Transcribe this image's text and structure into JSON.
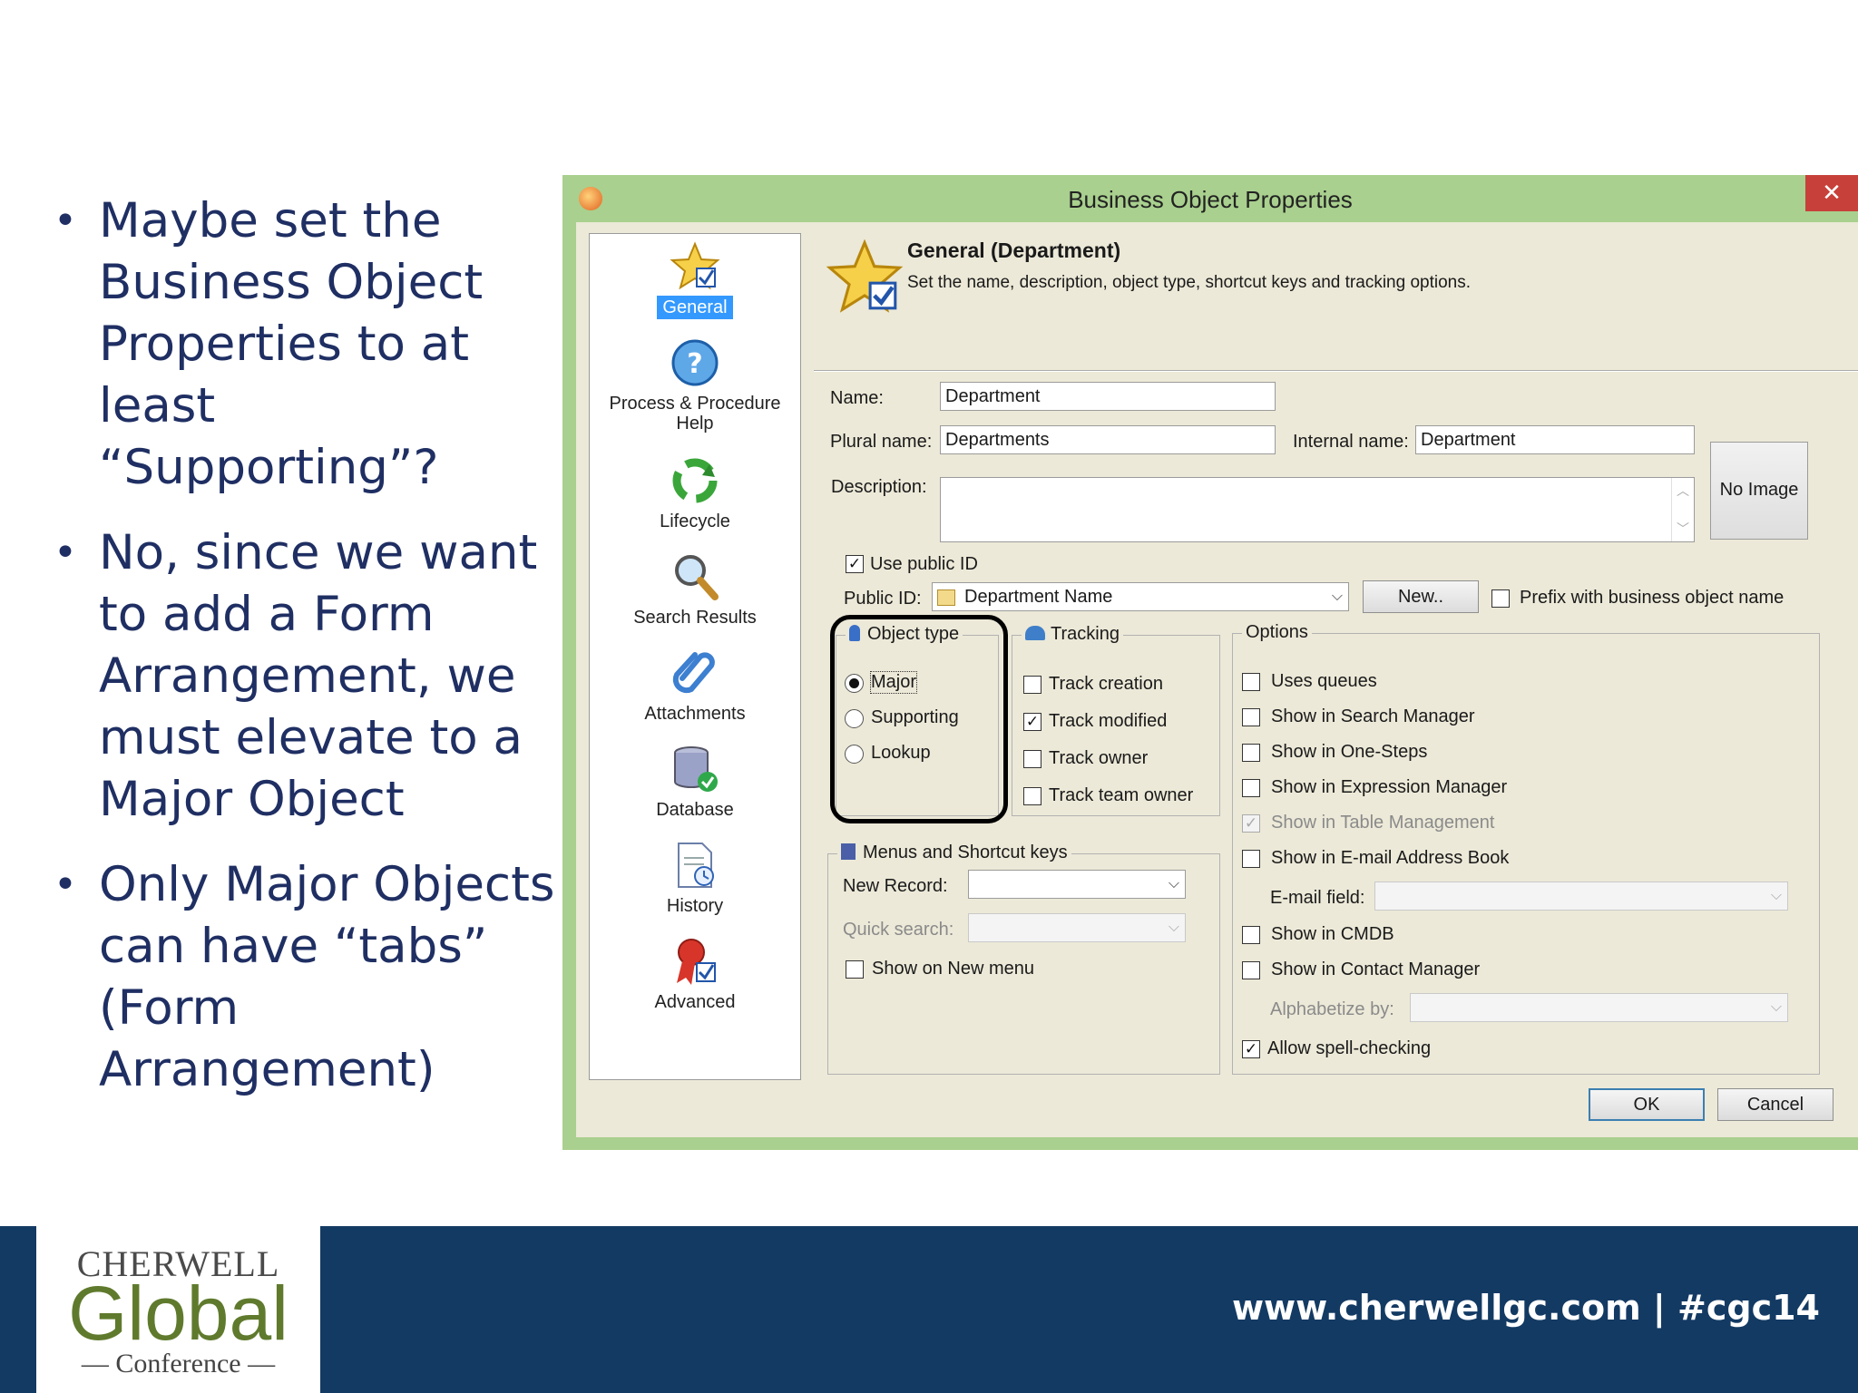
{
  "bullets": [
    "Maybe set the Business Object Properties to at least “Supporting”?",
    "No, since we want to add a Form Arrangement, we must elevate to a Major Object",
    "Only Major Objects can have “tabs” (Form Arrangement)"
  ],
  "window": {
    "title": "Business Object Properties",
    "close_glyph": "✕"
  },
  "sidebar": {
    "items": [
      {
        "label": "General",
        "icon": "star-check-icon",
        "selected": true
      },
      {
        "label": "Process & Procedure Help",
        "icon": "help-icon",
        "selected": false
      },
      {
        "label": "Lifecycle",
        "icon": "lifecycle-icon",
        "selected": false
      },
      {
        "label": "Search Results",
        "icon": "magnifier-icon",
        "selected": false
      },
      {
        "label": "Attachments",
        "icon": "paperclip-icon",
        "selected": false
      },
      {
        "label": "Database",
        "icon": "database-icon",
        "selected": false
      },
      {
        "label": "History",
        "icon": "history-icon",
        "selected": false
      },
      {
        "label": "Advanced",
        "icon": "ribbon-icon",
        "selected": false
      }
    ]
  },
  "header": {
    "title": "General  (Department)",
    "description": "Set the name, description, object type, shortcut keys and tracking options."
  },
  "form": {
    "name_label": "Name:",
    "name_value": "Department",
    "plural_label": "Plural name:",
    "plural_value": "Departments",
    "internal_label": "Internal name:",
    "internal_value": "Department",
    "no_image_label": "No Image",
    "description_label": "Description:",
    "description_value": "",
    "use_public_id_label": "Use public ID",
    "use_public_id_checked": true,
    "public_id_label": "Public ID:",
    "public_id_value": "Department Name",
    "new_button": "New..",
    "prefix_label": "Prefix with business object name",
    "prefix_checked": false
  },
  "object_type": {
    "legend": "Object type",
    "options": [
      {
        "label": "Major",
        "checked": true
      },
      {
        "label": "Supporting",
        "checked": false
      },
      {
        "label": "Lookup",
        "checked": false
      }
    ]
  },
  "tracking": {
    "legend": "Tracking",
    "items": [
      {
        "label": "Track creation",
        "checked": false
      },
      {
        "label": "Track modified",
        "checked": true
      },
      {
        "label": "Track owner",
        "checked": false
      },
      {
        "label": "Track team owner",
        "checked": false
      }
    ]
  },
  "menus": {
    "legend": "Menus and Shortcut keys",
    "new_record_label": "New Record:",
    "new_record_value": "",
    "quick_search_label": "Quick search:",
    "quick_search_value": "",
    "show_new_menu_label": "Show on New menu",
    "show_new_menu_checked": false
  },
  "options": {
    "legend": "Options",
    "items": [
      {
        "label": "Uses queues",
        "checked": false,
        "disabled": false
      },
      {
        "label": "Show in Search Manager",
        "checked": false,
        "disabled": false
      },
      {
        "label": "Show in One-Steps",
        "checked": false,
        "disabled": false
      },
      {
        "label": "Show in Expression Manager",
        "checked": false,
        "disabled": false
      },
      {
        "label": "Show in Table Management",
        "checked": true,
        "disabled": true
      },
      {
        "label": "Show in E-mail Address Book",
        "checked": false,
        "disabled": false
      }
    ],
    "email_field_label": "E-mail field:",
    "email_field_value": "",
    "items2": [
      {
        "label": "Show in CMDB",
        "checked": false,
        "disabled": false
      },
      {
        "label": "Show in Contact Manager",
        "checked": false,
        "disabled": false
      }
    ],
    "alphabetize_label": "Alphabetize by:",
    "alphabetize_value": "",
    "spell_label": "Allow spell-checking",
    "spell_checked": true
  },
  "buttons": {
    "ok": "OK",
    "cancel": "Cancel"
  },
  "footer": {
    "logo_top": "CHERWELL",
    "logo_mid": "Global",
    "logo_bottom": "— Conference —",
    "url": "www.cherwellgc.com | #cgc14"
  },
  "colors": {
    "bullet_text": "#1f2f63",
    "window_frame": "#a9d08e",
    "close_button": "#c7413a",
    "footer_bg": "#133a63",
    "selected_item": "#3399ff"
  }
}
